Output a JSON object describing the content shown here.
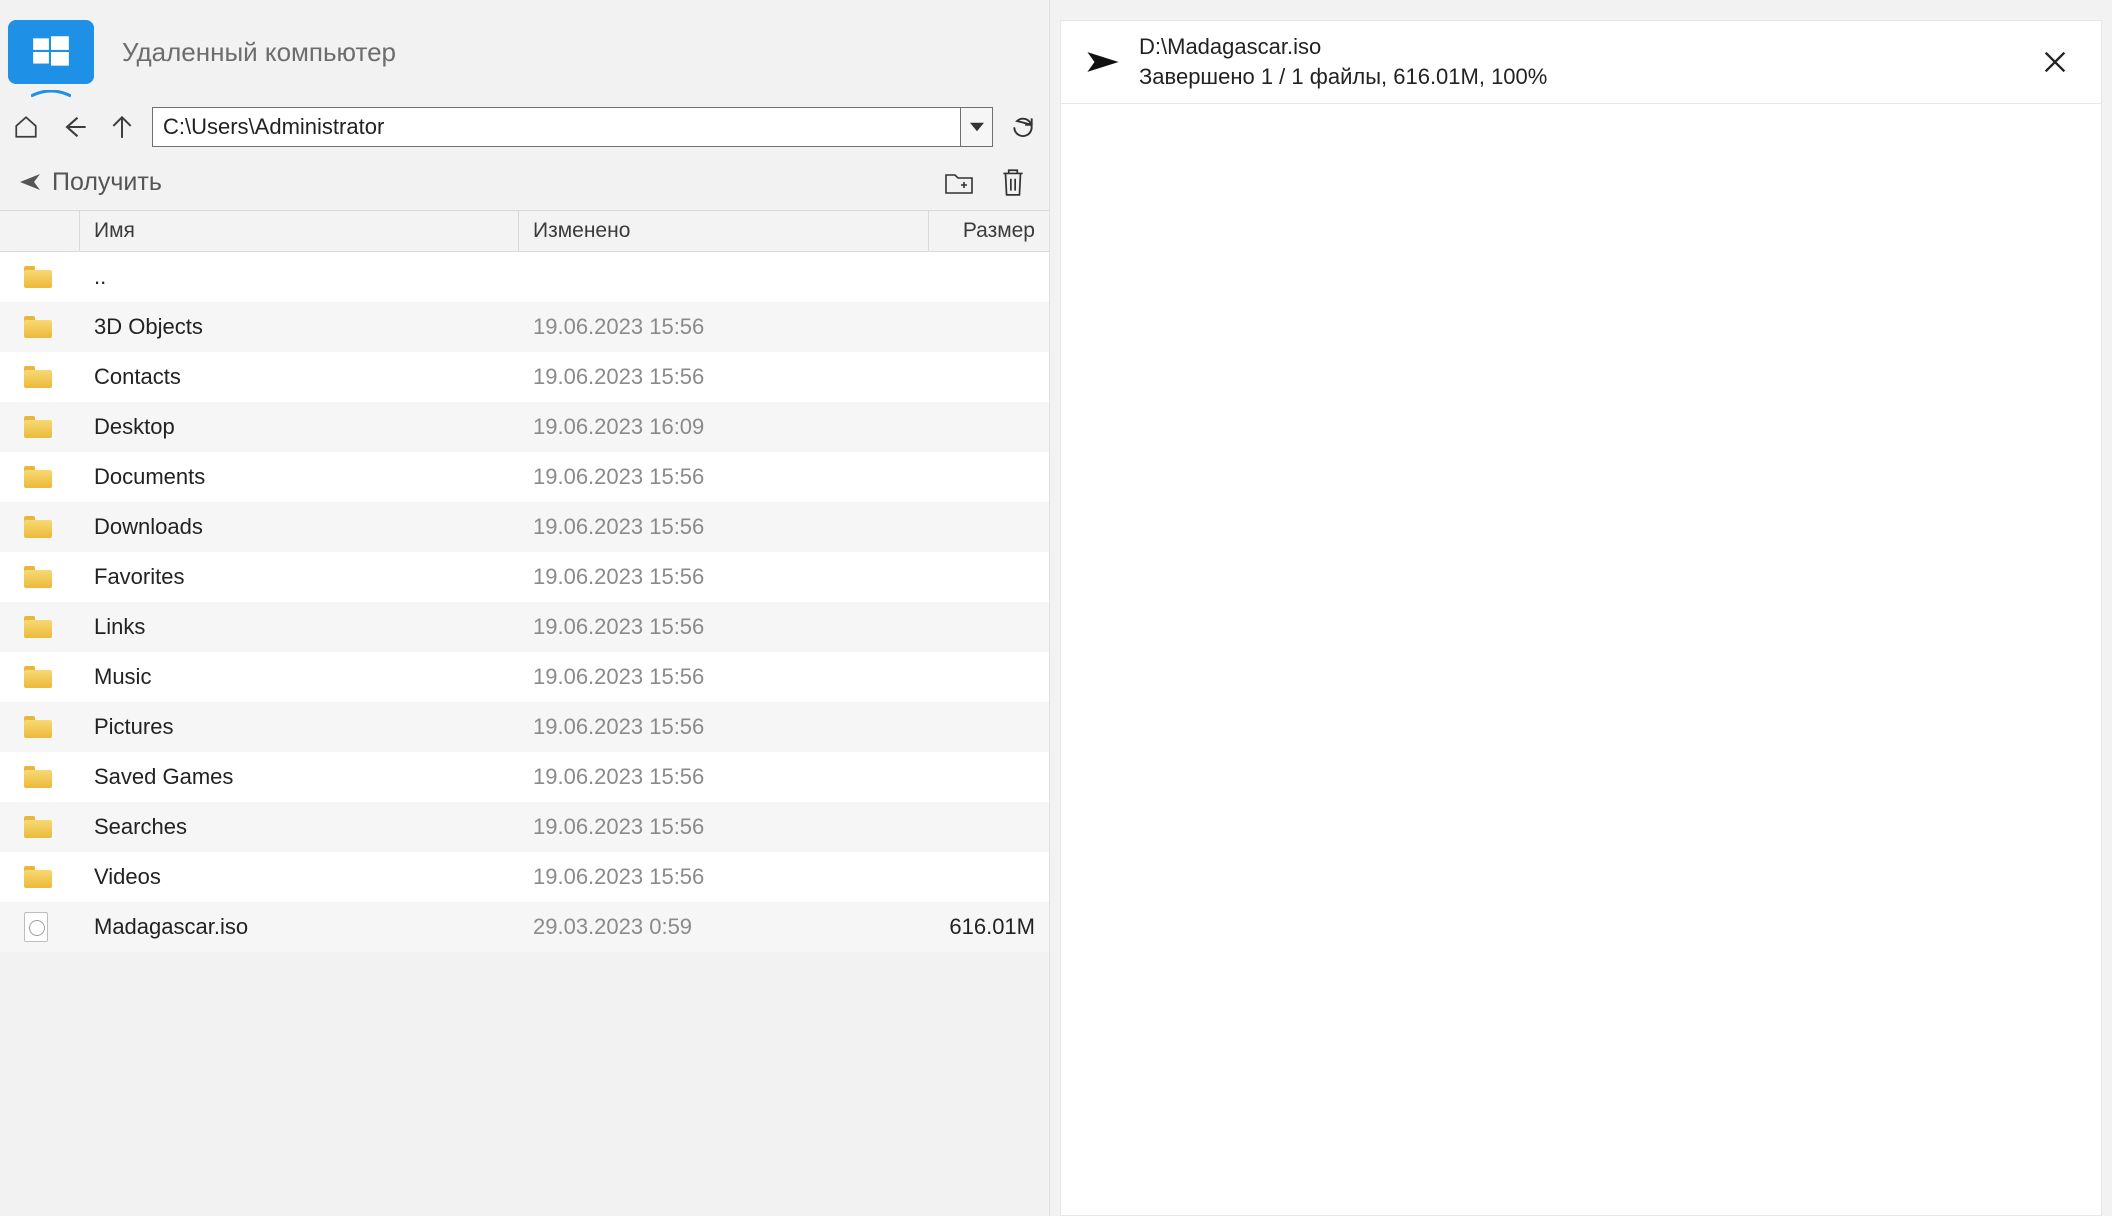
{
  "header": {
    "title": "Удаленный компьютер"
  },
  "nav": {
    "path": "C:\\Users\\Administrator"
  },
  "actions": {
    "receive_label": "Получить"
  },
  "columns": {
    "name": "Имя",
    "modified": "Изменено",
    "size": "Размер"
  },
  "rows": [
    {
      "icon": "folder",
      "name": "..",
      "modified": "",
      "size": ""
    },
    {
      "icon": "folder",
      "name": "3D Objects",
      "modified": "19.06.2023 15:56",
      "size": ""
    },
    {
      "icon": "folder",
      "name": "Contacts",
      "modified": "19.06.2023 15:56",
      "size": ""
    },
    {
      "icon": "folder",
      "name": "Desktop",
      "modified": "19.06.2023 16:09",
      "size": ""
    },
    {
      "icon": "folder",
      "name": "Documents",
      "modified": "19.06.2023 15:56",
      "size": ""
    },
    {
      "icon": "folder",
      "name": "Downloads",
      "modified": "19.06.2023 15:56",
      "size": ""
    },
    {
      "icon": "folder",
      "name": "Favorites",
      "modified": "19.06.2023 15:56",
      "size": ""
    },
    {
      "icon": "folder",
      "name": "Links",
      "modified": "19.06.2023 15:56",
      "size": ""
    },
    {
      "icon": "folder",
      "name": "Music",
      "modified": "19.06.2023 15:56",
      "size": ""
    },
    {
      "icon": "folder",
      "name": "Pictures",
      "modified": "19.06.2023 15:56",
      "size": ""
    },
    {
      "icon": "folder",
      "name": "Saved Games",
      "modified": "19.06.2023 15:56",
      "size": ""
    },
    {
      "icon": "folder",
      "name": "Searches",
      "modified": "19.06.2023 15:56",
      "size": ""
    },
    {
      "icon": "folder",
      "name": "Videos",
      "modified": "19.06.2023 15:56",
      "size": ""
    },
    {
      "icon": "file",
      "name": "Madagascar.iso",
      "modified": "29.03.2023 0:59",
      "size": "616.01M"
    }
  ],
  "transfer": {
    "path": "D:\\Madagascar.iso",
    "status": "Завершено 1 / 1 файлы, 616.01M, 100%"
  }
}
